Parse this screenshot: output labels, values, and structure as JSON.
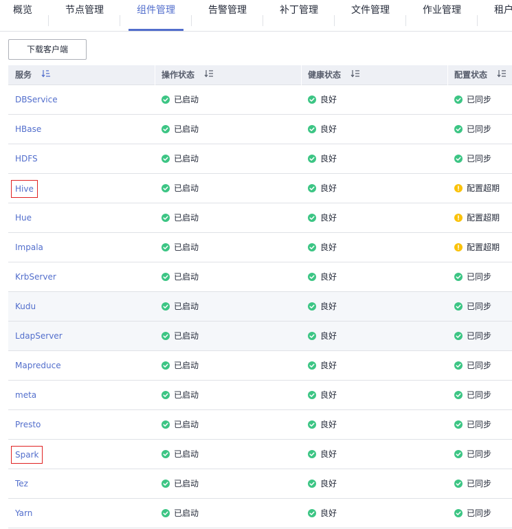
{
  "tabs": [
    {
      "label": "概览"
    },
    {
      "label": "节点管理"
    },
    {
      "label": "组件管理",
      "active": true
    },
    {
      "label": "告警管理"
    },
    {
      "label": "补丁管理"
    },
    {
      "label": "文件管理"
    },
    {
      "label": "作业管理"
    },
    {
      "label": "租户"
    }
  ],
  "toolbar": {
    "download_label": "下载客户端"
  },
  "table": {
    "headers": {
      "service": "服务",
      "op_status": "操作状态",
      "health_status": "健康状态",
      "config_status": "配置状态"
    },
    "rows": [
      {
        "service": "DBService",
        "op": "已启动",
        "health": "良好",
        "config": "已同步",
        "config_state": "ok"
      },
      {
        "service": "HBase",
        "op": "已启动",
        "health": "良好",
        "config": "已同步",
        "config_state": "ok"
      },
      {
        "service": "HDFS",
        "op": "已启动",
        "health": "良好",
        "config": "已同步",
        "config_state": "ok"
      },
      {
        "service": "Hive",
        "op": "已启动",
        "health": "良好",
        "config": "配置超期",
        "config_state": "warn",
        "boxed": true
      },
      {
        "service": "Hue",
        "op": "已启动",
        "health": "良好",
        "config": "配置超期",
        "config_state": "warn"
      },
      {
        "service": "Impala",
        "op": "已启动",
        "health": "良好",
        "config": "配置超期",
        "config_state": "warn"
      },
      {
        "service": "KrbServer",
        "op": "已启动",
        "health": "良好",
        "config": "已同步",
        "config_state": "ok"
      },
      {
        "service": "Kudu",
        "op": "已启动",
        "health": "良好",
        "config": "已同步",
        "config_state": "ok",
        "highlight": true
      },
      {
        "service": "LdapServer",
        "op": "已启动",
        "health": "良好",
        "config": "已同步",
        "config_state": "ok",
        "highlight": true
      },
      {
        "service": "Mapreduce",
        "op": "已启动",
        "health": "良好",
        "config": "已同步",
        "config_state": "ok"
      },
      {
        "service": "meta",
        "op": "已启动",
        "health": "良好",
        "config": "已同步",
        "config_state": "ok"
      },
      {
        "service": "Presto",
        "op": "已启动",
        "health": "良好",
        "config": "已同步",
        "config_state": "ok"
      },
      {
        "service": "Spark",
        "op": "已启动",
        "health": "良好",
        "config": "已同步",
        "config_state": "ok",
        "boxed": true
      },
      {
        "service": "Tez",
        "op": "已启动",
        "health": "良好",
        "config": "已同步",
        "config_state": "ok"
      },
      {
        "service": "Yarn",
        "op": "已启动",
        "health": "良好",
        "config": "已同步",
        "config_state": "ok"
      }
    ]
  },
  "colors": {
    "accent": "#526ecc",
    "ok": "#3cc584",
    "warn": "#fac20a",
    "annotation_box": "#e02020"
  },
  "icons": {
    "ok": "check-circle-icon",
    "warn": "exclamation-circle-icon",
    "sort": "sort-icon"
  }
}
